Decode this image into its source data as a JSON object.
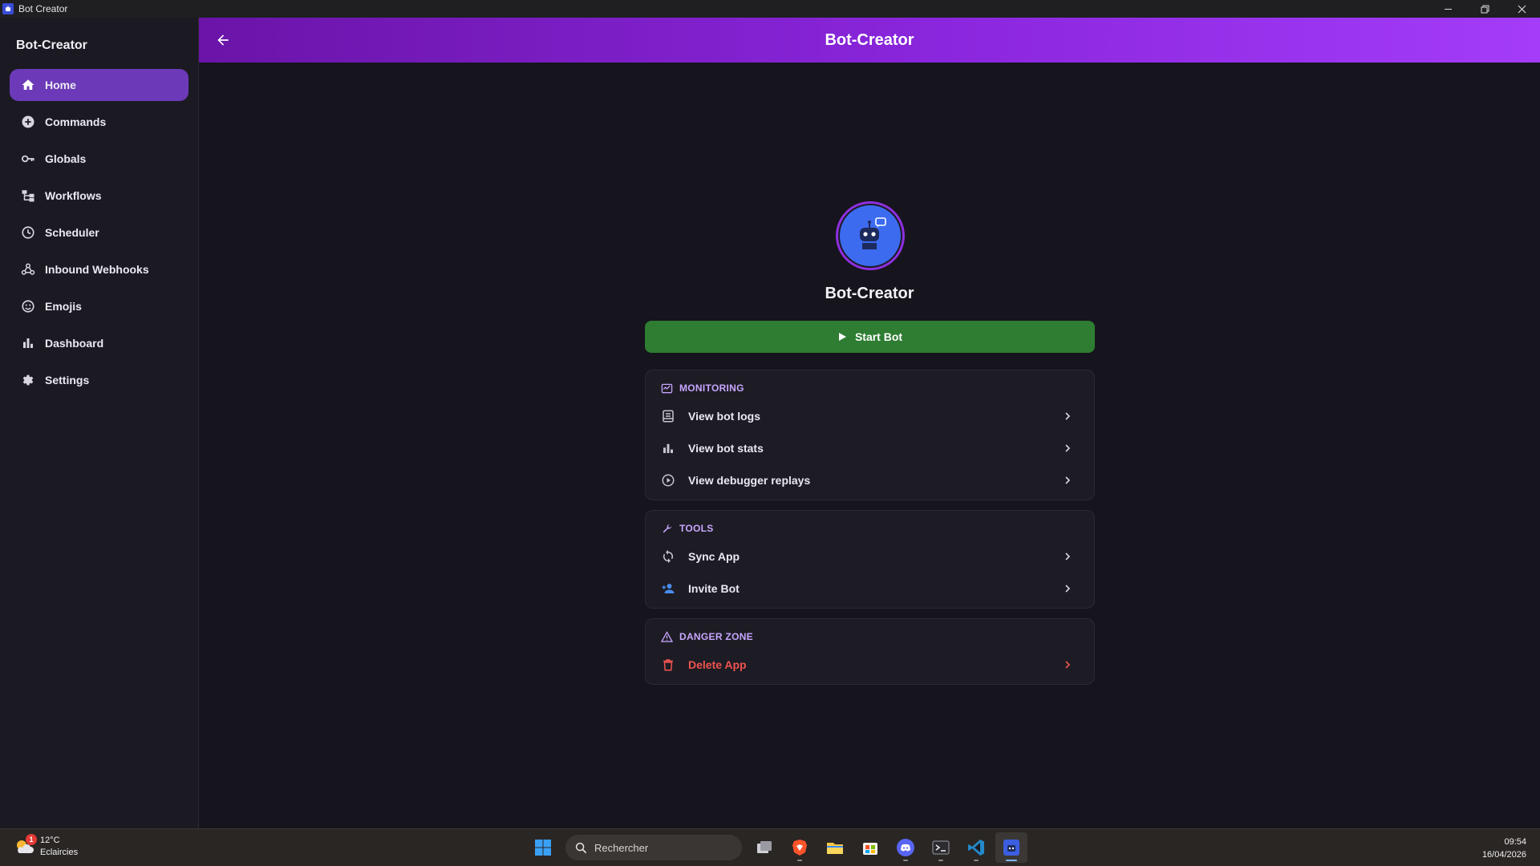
{
  "window": {
    "title": "Bot Creator"
  },
  "sidebar": {
    "brand": "Bot-Creator",
    "items": [
      {
        "label": "Home",
        "icon": "home-icon",
        "active": true
      },
      {
        "label": "Commands",
        "icon": "add-circle-icon"
      },
      {
        "label": "Globals",
        "icon": "key-icon"
      },
      {
        "label": "Workflows",
        "icon": "workflow-icon"
      },
      {
        "label": "Scheduler",
        "icon": "clock-icon"
      },
      {
        "label": "Inbound Webhooks",
        "icon": "webhook-icon"
      },
      {
        "label": "Emojis",
        "icon": "emoji-icon"
      },
      {
        "label": "Dashboard",
        "icon": "bar-chart-icon"
      },
      {
        "label": "Settings",
        "icon": "gear-icon"
      }
    ]
  },
  "header": {
    "title": "Bot-Creator"
  },
  "profile": {
    "name": "Bot-Creator"
  },
  "actions": {
    "start_label": "Start Bot"
  },
  "monitoring": {
    "title": "MONITORING",
    "items": [
      {
        "label": "View bot logs",
        "icon": "logs-icon"
      },
      {
        "label": "View bot stats",
        "icon": "bar-chart-icon"
      },
      {
        "label": "View debugger replays",
        "icon": "play-circle-icon"
      }
    ]
  },
  "tools": {
    "title": "TOOLS",
    "items": [
      {
        "label": "Sync App",
        "icon": "sync-icon"
      },
      {
        "label": "Invite Bot",
        "icon": "person-add-icon"
      }
    ]
  },
  "danger": {
    "title": "DANGER ZONE",
    "items": [
      {
        "label": "Delete App",
        "icon": "trash-icon"
      }
    ]
  },
  "taskbar": {
    "weather": {
      "temp": "12°C",
      "condition": "Eclaircies",
      "badge": "1"
    },
    "search_placeholder": "Rechercher",
    "time": "09:54",
    "date": "16/04/2026"
  },
  "colors": {
    "accent": "#6c3ab8",
    "header_start": "#6a14a8",
    "header_end": "#a43cf8",
    "start_green": "#2e7d32",
    "danger_red": "#ef5350",
    "section_label": "#c8a6ff"
  }
}
